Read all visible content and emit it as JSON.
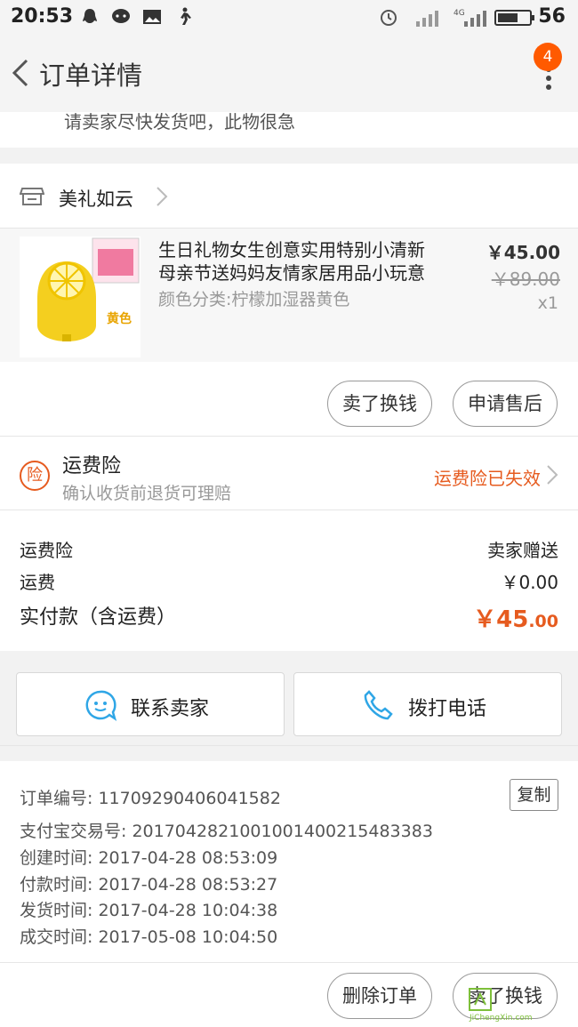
{
  "status_bar": {
    "time": "20:53",
    "battery": "56"
  },
  "header": {
    "title": "订单详情",
    "badge_count": "4"
  },
  "partial_message": "请卖家尽快发货吧，此物很急",
  "shop": {
    "name": "美礼如云"
  },
  "product": {
    "title_line1": "生日礼物女生创意实用特别小清新",
    "title_line2": "母亲节送妈妈友情家居用品小玩意",
    "spec": "颜色分类:柠檬加湿器黄色",
    "price": "￥45.00",
    "original_price": "￥89.00",
    "quantity": "x1",
    "image_label": "黄色"
  },
  "product_actions": {
    "sell_swap": "卖了换钱",
    "after_sale": "申请售后"
  },
  "insurance": {
    "title": "运费险",
    "subtitle": "确认收货前退货可理赔",
    "status": "运费险已失效"
  },
  "summary": {
    "rows": [
      {
        "label": "运费险",
        "value": "卖家赠送"
      },
      {
        "label": "运费",
        "value": "￥0.00"
      }
    ],
    "total_label": "实付款（含运费）",
    "total_int": "￥45",
    "total_dec": ".00"
  },
  "contact": {
    "seller": "联系卖家",
    "call": "拨打电话"
  },
  "order_info": {
    "order_no": "订单编号: 11709290406041582",
    "alipay_no": "支付宝交易号: 2017042821001001400215483383",
    "created": "创建时间: 2017-04-28 08:53:09",
    "paid": "付款时间: 2017-04-28 08:53:27",
    "shipped": "发货时间: 2017-04-28 10:04:38",
    "completed": "成交时间: 2017-05-08 10:04:50",
    "copy_label": "复制"
  },
  "bottom_actions": {
    "delete_order": "删除订单",
    "sell_swap": "卖了换钱"
  },
  "watermark": "JiChengXin.com",
  "colors": {
    "accent": "#e65b1f",
    "badge": "#ff5a00",
    "contact_icon": "#2fa6e6"
  }
}
